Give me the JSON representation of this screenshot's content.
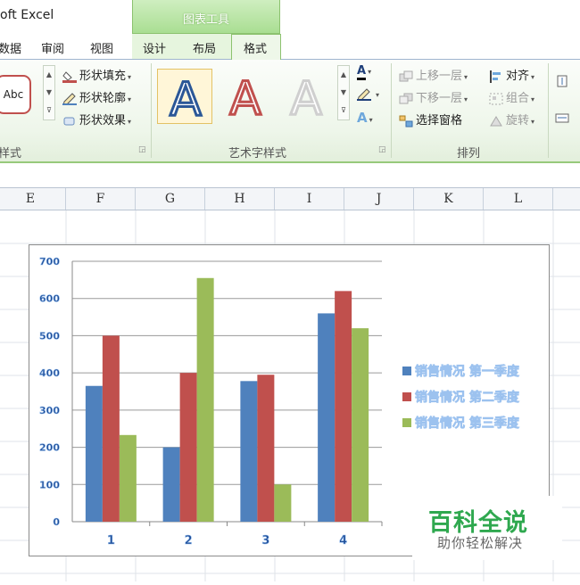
{
  "title_bar": {
    "app_title": "oft Excel",
    "context_tab_label": "图表工具"
  },
  "tabs": [
    {
      "label": "数据",
      "active": false
    },
    {
      "label": "审阅",
      "active": false
    },
    {
      "label": "视图",
      "active": false
    },
    {
      "label": "设计",
      "active": false
    },
    {
      "label": "布局",
      "active": false
    },
    {
      "label": "格式",
      "active": true
    }
  ],
  "ribbon": {
    "shape_styles": {
      "group_label": "样式",
      "preview_text": "Abc",
      "fill": "形状填充",
      "outline": "形状轮廓",
      "effects": "形状效果"
    },
    "wordart_styles": {
      "group_label": "艺术字样式",
      "samples": [
        "A",
        "A",
        "A"
      ],
      "sample_colors": [
        "#2b5797",
        "#c0504d",
        "#d9d9d9"
      ]
    },
    "arrange": {
      "group_label": "排列",
      "bring_forward": "上移一层",
      "send_backward": "下移一层",
      "selection_pane": "选择窗格",
      "align": "对齐",
      "group": "组合",
      "rotate": "旋转"
    }
  },
  "columns": [
    "E",
    "F",
    "G",
    "H",
    "I",
    "J",
    "K",
    "L"
  ],
  "chart_data": {
    "type": "bar",
    "categories": [
      "1",
      "2",
      "3",
      "4"
    ],
    "series": [
      {
        "name": "销售情况 第一季度",
        "color": "#4f81bd",
        "values": [
          365,
          200,
          378,
          560
        ]
      },
      {
        "name": "销售情况 第二季度",
        "color": "#c0504d",
        "values": [
          500,
          400,
          395,
          620
        ]
      },
      {
        "name": "销售情况 第三季度",
        "color": "#9bbb59",
        "values": [
          233,
          655,
          100,
          520
        ]
      }
    ],
    "ylim": [
      0,
      700
    ],
    "yticks": [
      "0",
      "100",
      "200",
      "300",
      "400",
      "500",
      "600",
      "700"
    ],
    "grid": true,
    "legend_position": "right",
    "label_color": "#1f4e99"
  },
  "watermark": {
    "title": "百科全说",
    "subtitle": "助你轻松解决"
  }
}
